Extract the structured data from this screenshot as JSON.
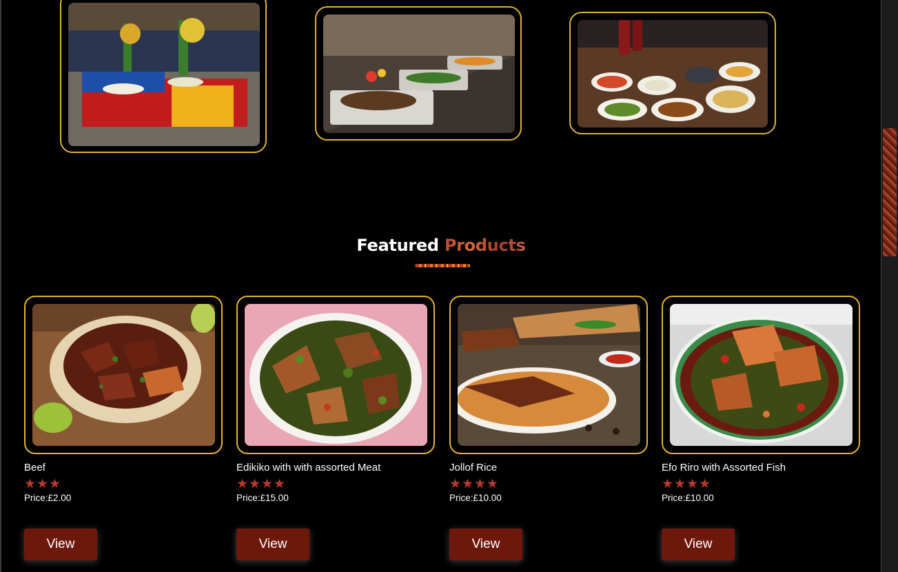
{
  "gallery": [
    {
      "icon": "banquet-buffet-photo"
    },
    {
      "icon": "chafing-dish-buffet-photo"
    },
    {
      "icon": "dining-table-dishes-photo"
    }
  ],
  "section": {
    "title_plain": "Featured",
    "title_accent": "Products"
  },
  "products": [
    {
      "name": "Beef",
      "rating": 3,
      "price": "Price:£2.00",
      "button": "View"
    },
    {
      "name": "Edikiko with with assorted Meat",
      "rating": 4,
      "price": "Price:£15.00",
      "button": "View"
    },
    {
      "name": "Jollof Rice",
      "rating": 4,
      "price": "Price:£10.00",
      "button": "View"
    },
    {
      "name": "Efo Riro with Assorted Fish",
      "rating": 4,
      "price": "Price:£10.00",
      "button": "View"
    }
  ],
  "colors": {
    "background": "#000000",
    "card_border": "#e6b42c",
    "button": "#6e180c",
    "star": "#b83a2a"
  }
}
